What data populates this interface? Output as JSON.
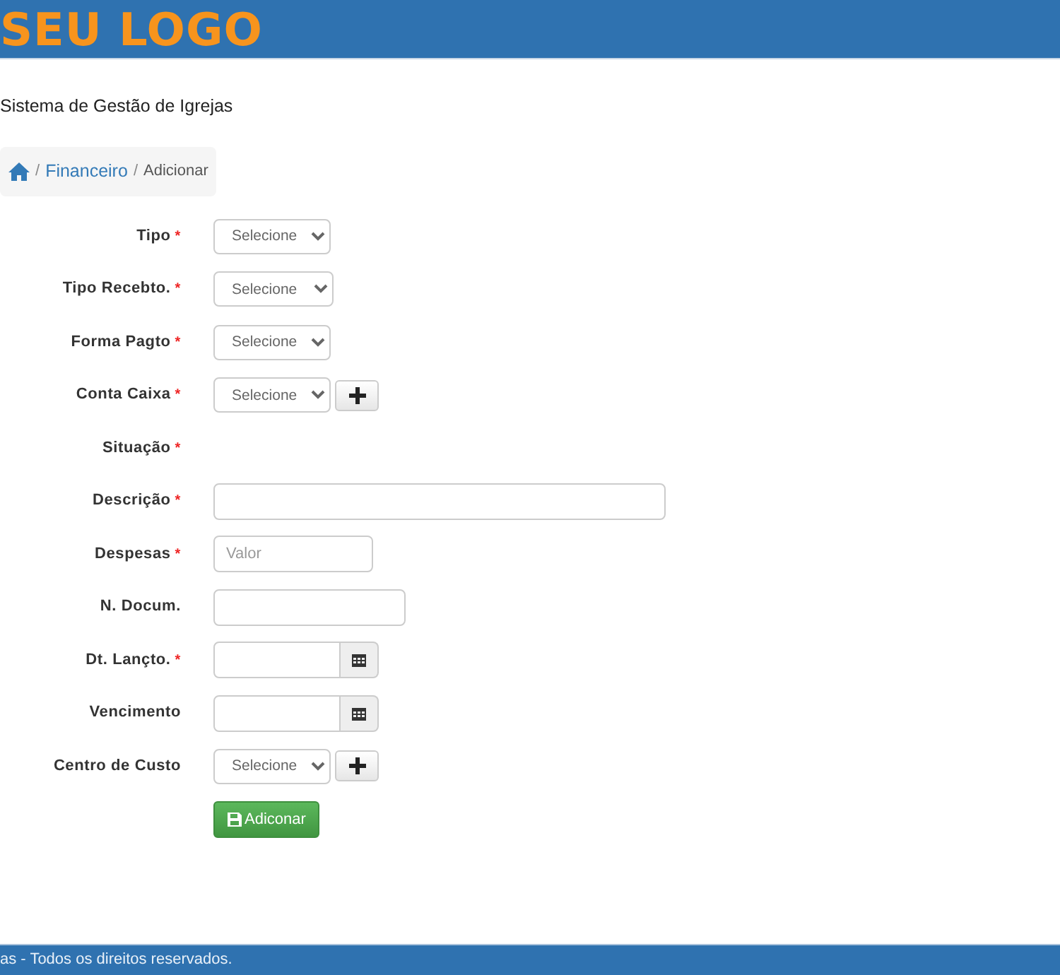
{
  "header": {
    "logo": "SEU LOGO"
  },
  "page_title": "Sistema de Gestão de Igrejas",
  "breadcrumb": [
    {
      "kind": "home"
    },
    {
      "kind": "separator",
      "label": "/"
    },
    {
      "kind": "link",
      "label": "Financeiro"
    },
    {
      "kind": "separator",
      "label": "/"
    },
    {
      "kind": "current",
      "label": "Adicionar"
    }
  ],
  "form": [
    {
      "label": "Tipo",
      "required_mark": "*",
      "kind": "select",
      "value": "Selecione"
    },
    {
      "label": "Tipo Recebto.",
      "required_mark": "*",
      "kind": "select",
      "value": "Selecione"
    },
    {
      "label": "Forma Pagto",
      "required_mark": "*",
      "kind": "select",
      "value": "Selecione"
    },
    {
      "label": "Conta Caixa",
      "required_mark": "*",
      "kind": "select_add",
      "value": "Selecione"
    },
    {
      "label": "Situação",
      "required_mark": "*",
      "kind": "none"
    },
    {
      "label": "Descrição",
      "required_mark": "*",
      "kind": "text_wide"
    },
    {
      "label": "Despesas",
      "required_mark": "*",
      "kind": "text_short",
      "placeholder": "Valor"
    },
    {
      "label": "N. Docum.",
      "kind": "text_medium"
    },
    {
      "label": "Dt. Lançto.",
      "required_mark": "*",
      "kind": "date"
    },
    {
      "label": "Vencimento",
      "kind": "date"
    },
    {
      "label": "Centro de Custo",
      "kind": "select_add",
      "value": "Selecione"
    }
  ],
  "submit": {
    "label": "Adiconar"
  },
  "footer": {
    "text": "as - Todos os direitos reservados."
  }
}
